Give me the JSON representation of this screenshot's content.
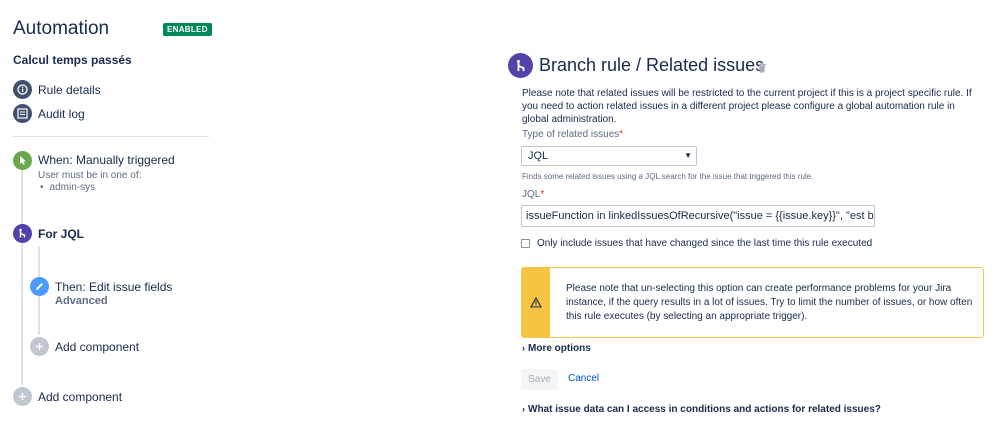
{
  "header": {
    "title": "Automation",
    "status_badge": "ENABLED"
  },
  "rule": {
    "name": "Calcul temps passés"
  },
  "menu": [
    {
      "label": "Rule details",
      "icon": "info-icon"
    },
    {
      "label": "Audit log",
      "icon": "list-icon"
    }
  ],
  "flow": {
    "trigger": {
      "title": "When: Manually triggered",
      "sub": "User must be in one of:",
      "bullet": "admin-sys",
      "icon": "pointer-icon",
      "color": "#6aa84f"
    },
    "branch": {
      "title": "For JQL",
      "icon": "branch-icon",
      "color": "#5243aa"
    },
    "action": {
      "title": "Then: Edit issue fields",
      "sub": "Advanced",
      "icon": "pencil-icon",
      "color": "#4c9aff"
    },
    "add_inner": "Add component",
    "add_outer": "Add component"
  },
  "panel": {
    "title": "Branch rule / Related issues",
    "note": "Please note that related issues will be restricted to the current project if this is a project specific rule. If you need to action related issues in a different project please configure a global automation rule in global administration.",
    "type_label": "Type of related issues",
    "type_value": "JQL",
    "type_help": "Finds some related issues using a JQL search for the issue that triggered this rule.",
    "jql_label": "JQL",
    "jql_value": "issueFunction in linkedIssuesOfRecursive(\"issue = {{issue.key}}\", \"est bloquée",
    "checkbox_label": "Only include issues that have changed since the last time this rule executed",
    "checkbox_checked": false,
    "warning_text": "Please note that un-selecting this option can create performance problems for your Jira instance, if the query results in a lot of issues. Try to limit the number of issues, or how often this rule executes (by selecting an appropriate trigger).",
    "more_options": "More options",
    "save_label": "Save",
    "cancel_label": "Cancel",
    "faq": "What issue data can I access in conditions and actions for related issues?"
  }
}
